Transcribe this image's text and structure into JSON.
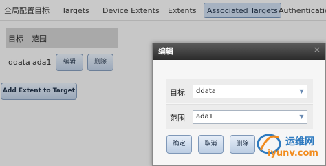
{
  "tabs": [
    {
      "label": "全局配置目标"
    },
    {
      "label": "Targets"
    },
    {
      "label": "Device Extents"
    },
    {
      "label": "Extents"
    },
    {
      "label": "Associated Targets",
      "active": true
    },
    {
      "label": "Authentication"
    }
  ],
  "table": {
    "headers": [
      "目标",
      "范围"
    ],
    "rows": [
      {
        "target": "ddata",
        "extent": "ada1",
        "edit_label": "编辑",
        "delete_label": "删除"
      }
    ]
  },
  "add_button_label": "Add Extent to Target",
  "dialog": {
    "title": "编辑",
    "close_icon": "close-icon",
    "fields": [
      {
        "label": "目标",
        "value": "ddata"
      },
      {
        "label": "范围",
        "value": "ada1"
      }
    ],
    "ok_label": "确定",
    "cancel_label": "取消",
    "delete_label": "删除"
  },
  "watermark": {
    "name": "运维网",
    "url": "iyunv.com"
  },
  "colors": {
    "active_tab": "#c9d9ec",
    "button_border": "#7f98b8",
    "dialog_titlebar": "#2b2b2b",
    "watermark_blue": "#2f7bc0",
    "watermark_orange": "#f28c1e"
  }
}
